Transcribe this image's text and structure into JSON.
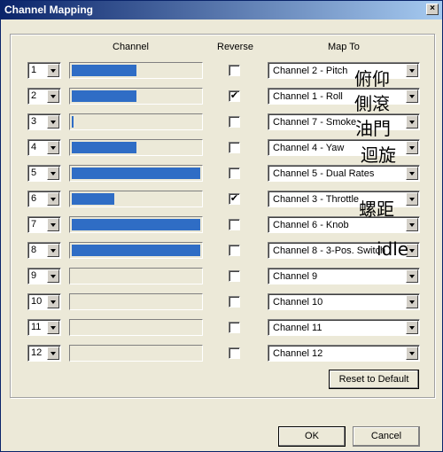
{
  "window": {
    "title": "Channel Mapping",
    "close_glyph": "×"
  },
  "headers": {
    "channel": "Channel",
    "reverse": "Reverse",
    "map_to": "Map To"
  },
  "rows": [
    {
      "num": "1",
      "level": 0.5,
      "reverse": false,
      "map": "Channel 2 - Pitch",
      "note": "俯仰"
    },
    {
      "num": "2",
      "level": 0.5,
      "reverse": true,
      "map": "Channel 1 - Roll",
      "note": "側滾"
    },
    {
      "num": "3",
      "level": 0.01,
      "reverse": false,
      "map": "Channel 7 - Smoke",
      "note": "油門"
    },
    {
      "num": "4",
      "level": 0.5,
      "reverse": false,
      "map": "Channel 4 - Yaw",
      "note": "迴旋"
    },
    {
      "num": "5",
      "level": 1.0,
      "reverse": false,
      "map": "Channel 5 - Dual Rates",
      "note": ""
    },
    {
      "num": "6",
      "level": 0.33,
      "reverse": true,
      "map": "Channel 3 - Throttle",
      "note": "螺距"
    },
    {
      "num": "7",
      "level": 1.0,
      "reverse": false,
      "map": "Channel 6 - Knob",
      "note": ""
    },
    {
      "num": "8",
      "level": 1.0,
      "reverse": false,
      "map": "Channel 8 - 3-Pos. Switch",
      "note": "idle"
    },
    {
      "num": "9",
      "level": 0,
      "reverse": false,
      "map": "Channel 9",
      "note": ""
    },
    {
      "num": "10",
      "level": 0,
      "reverse": false,
      "map": "Channel 10",
      "note": ""
    },
    {
      "num": "11",
      "level": 0,
      "reverse": false,
      "map": "Channel 11",
      "note": ""
    },
    {
      "num": "12",
      "level": 0,
      "reverse": false,
      "map": "Channel 12",
      "note": ""
    }
  ],
  "buttons": {
    "reset": "Reset to Default",
    "ok": "OK",
    "cancel": "Cancel"
  },
  "colors": {
    "bar_fill": "#2f6dc5",
    "title_start": "#0a246a",
    "title_end": "#a6caf0"
  },
  "icons": {
    "dropdown": "chevron-down-icon",
    "checkmark": "check-icon"
  }
}
